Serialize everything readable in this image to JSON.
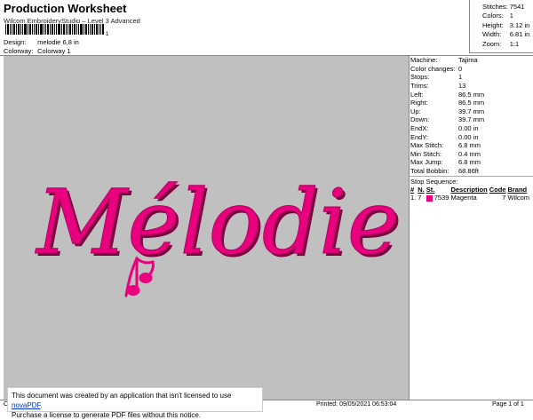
{
  "header": {
    "title": "Production Worksheet",
    "subtitle": "Wilcom EmbroideryStudio – Level 3 Advanced",
    "barcode_digit": "1",
    "design_label": "Design:",
    "design_value": "melodie 6,8 in",
    "colorway_label": "Colorway:",
    "colorway_value": "Colorway 1"
  },
  "stats": [
    {
      "label": "Stitches:",
      "value": "7541"
    },
    {
      "label": "Colors:",
      "value": "1"
    },
    {
      "label": "Height:",
      "value": "3.12 in"
    },
    {
      "label": "Width:",
      "value": "6.81 in"
    },
    {
      "label": "Zoom:",
      "value": "1:1"
    }
  ],
  "specs": [
    {
      "label": "Machine:",
      "value": "Tajima"
    },
    {
      "label": "Color changes:",
      "value": "0"
    },
    {
      "label": "Stops:",
      "value": "1"
    },
    {
      "label": "Trims:",
      "value": "13"
    },
    {
      "label": "Left:",
      "value": "86.5 mm"
    },
    {
      "label": "Right:",
      "value": "86.5 mm"
    },
    {
      "label": "Up:",
      "value": "39.7 mm"
    },
    {
      "label": "Down:",
      "value": "39.7 mm"
    },
    {
      "label": "EndX:",
      "value": "0.00 in"
    },
    {
      "label": "EndY:",
      "value": "0.00 in"
    },
    {
      "label": "Max Stitch:",
      "value": "6.8 mm"
    },
    {
      "label": "Min Stitch:",
      "value": "0.4 mm"
    },
    {
      "label": "Max Jump:",
      "value": "6.8 mm"
    },
    {
      "label": "Total Bobbin:",
      "value": "68.86ft"
    }
  ],
  "stop_sequence": {
    "heading": "Stop Sequence:",
    "columns": [
      "#",
      "N.",
      "St.",
      "Description",
      "Code",
      "Brand"
    ],
    "rows": [
      {
        "num": "1.",
        "n": "7",
        "st": "7539",
        "description": "Magenta",
        "code": "7",
        "brand": "Wilcom",
        "color": "#e6007e"
      }
    ]
  },
  "design": {
    "text": "Mélodie",
    "thread_color": "#e8007f",
    "canvas_color": "#c0c0c0"
  },
  "notice": {
    "line1_prefix": "This document was created by an application that isn't licensed to use ",
    "link": "novaPDF",
    "line1_suffix": ".",
    "line2": "Purchase a license to generate PDF files without this notice."
  },
  "footer": {
    "left": "Cr",
    "printed": "Printed: 09/05/2021 06:53:04",
    "page": "Page 1 of 1"
  }
}
